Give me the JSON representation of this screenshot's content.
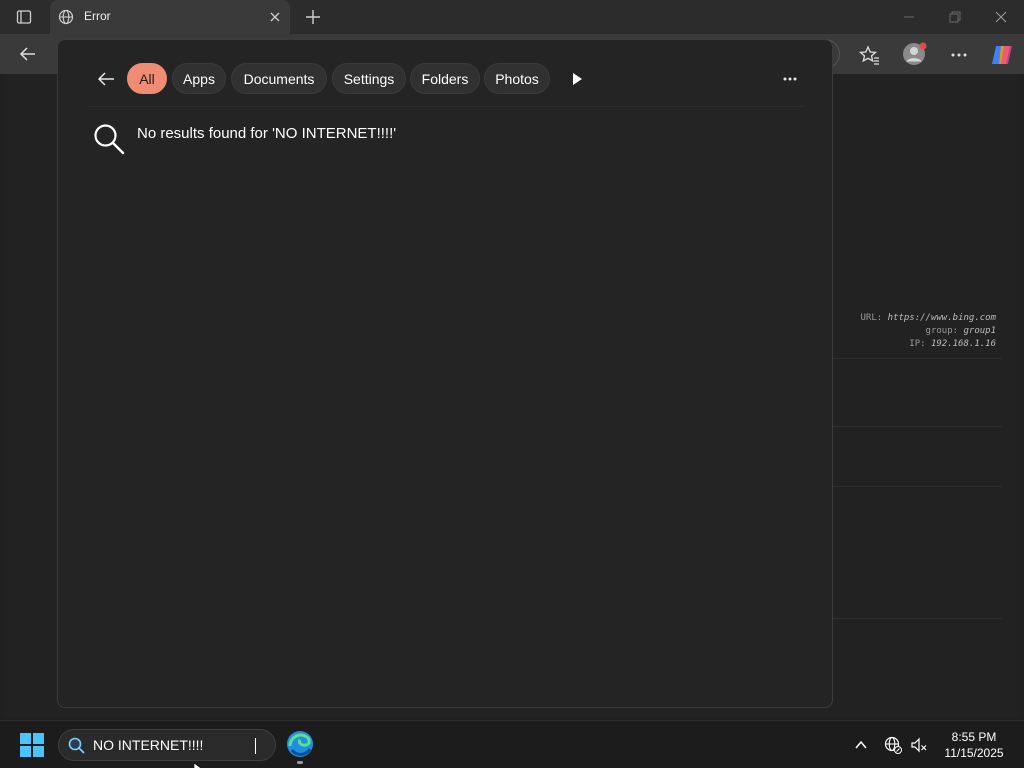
{
  "browser": {
    "tab_title": "Error"
  },
  "page_behind": {
    "info_lines": [
      {
        "label": "URL:",
        "value": "https://www.bing.com"
      },
      {
        "label": "group:",
        "value": "group1"
      },
      {
        "label": "IP:",
        "value": "192.168.1.16"
      }
    ]
  },
  "search_flyout": {
    "filters": [
      {
        "label": "All",
        "active": true
      },
      {
        "label": "Apps",
        "active": false
      },
      {
        "label": "Documents",
        "active": false
      },
      {
        "label": "Settings",
        "active": false
      },
      {
        "label": "Folders",
        "active": false
      },
      {
        "label": "Photos",
        "active": false
      }
    ],
    "result_message": "No results found for 'NO INTERNET!!!!'",
    "accent_color": "#f08b74"
  },
  "taskbar": {
    "search_value": "NO INTERNET!!!!",
    "clock_time": "8:55 PM",
    "clock_date": "11/15/2025"
  },
  "icons": {
    "browser": [
      "tab-actions-icon",
      "globe-icon",
      "close-icon",
      "plus-icon",
      "minimize-icon",
      "restore-icon",
      "window-close-icon"
    ],
    "toolbar": [
      "back-arrow-icon",
      "favorites-icon",
      "profile-icon",
      "more-icon",
      "copilot-icon"
    ],
    "flyout": [
      "back-arrow-icon",
      "play-arrow-icon",
      "more-icon",
      "search-icon"
    ],
    "taskbar": [
      "windows-logo-icon",
      "search-icon",
      "edge-icon",
      "chevron-up-icon",
      "network-globe-icon",
      "speaker-muted-icon"
    ]
  }
}
